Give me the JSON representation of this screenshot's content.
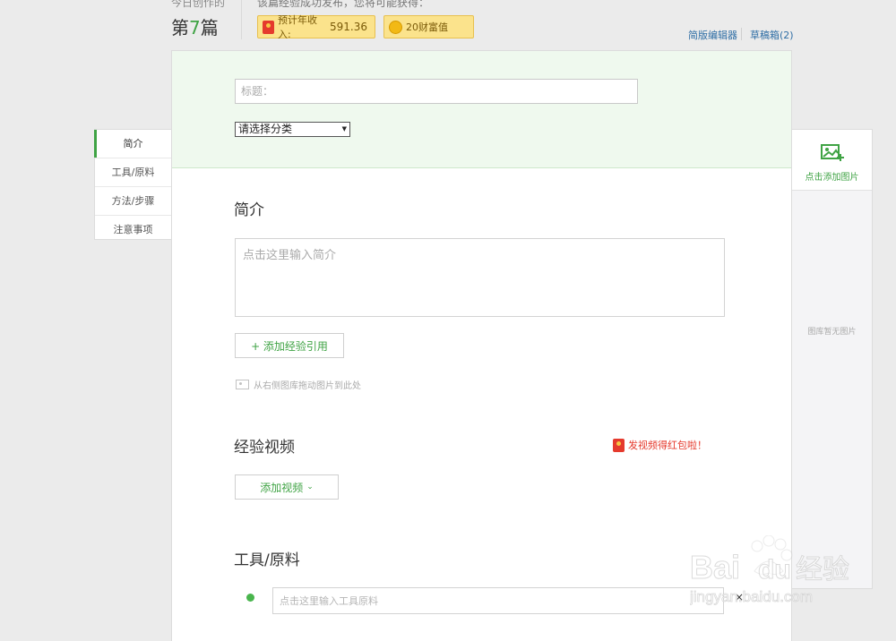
{
  "header": {
    "today_label": "今日创作的",
    "count_prefix": "第",
    "count_number": "7",
    "count_suffix": "篇",
    "reward_label": "该篇经验成功发布，您将可能获得：",
    "income_label": "预计年收入:",
    "income_value": "591.36",
    "wealth_label": "20财富值",
    "simple_editor_link": "简版编辑器",
    "drafts_link": "草稿箱(2)"
  },
  "left_nav": {
    "items": [
      {
        "label": "简介",
        "active": true
      },
      {
        "label": "工具/原料",
        "active": false
      },
      {
        "label": "方法/步骤",
        "active": false
      },
      {
        "label": "注意事项",
        "active": false
      }
    ]
  },
  "form": {
    "title_placeholder": "标题：",
    "category_select": "请选择分类",
    "intro_heading": "简介",
    "intro_placeholder": "点击这里输入简介",
    "add_reference_button": "+ 添加经验引用",
    "drag_hint": "从右侧图库拖动图片到此处",
    "video_heading": "经验视频",
    "video_promo": "发视频得红包啦！",
    "add_video_button": "添加视频",
    "tools_heading": "工具/原料",
    "tools_placeholder": "点击这里输入工具原料",
    "remove_glyph": "×"
  },
  "gallery": {
    "add_label": "点击添加图片",
    "empty_label": "图库暂无图片"
  },
  "watermark": {
    "brand": "Bai",
    "brand_du": "du",
    "brand_cn": "经验",
    "url": "jingyan.baidu.com"
  },
  "colors": {
    "accent_green": "#3fa344",
    "link_blue": "#2f6ea5",
    "badge_gold": "#fbe38c",
    "promo_red": "#e53a2d"
  }
}
